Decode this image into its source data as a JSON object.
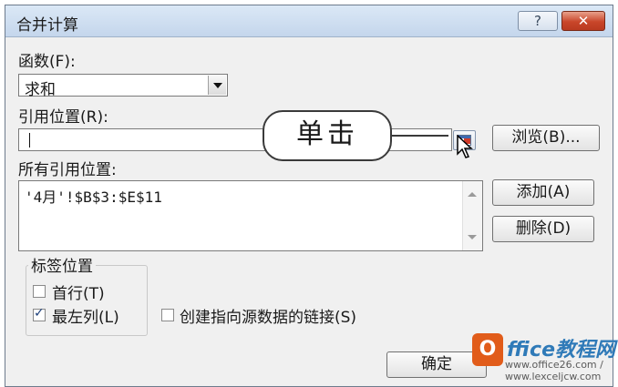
{
  "dialog": {
    "title": "合并计算",
    "help_label": "?",
    "close_label": "✕"
  },
  "function": {
    "label": "函数(F):",
    "selected": "求和"
  },
  "reference": {
    "label": "引用位置(R):",
    "value": "",
    "browse_label": "浏览(B)..."
  },
  "all_references": {
    "label": "所有引用位置:",
    "items": [
      "'4月'!$B$3:$E$11"
    ],
    "add_label": "添加(A)",
    "delete_label": "删除(D)"
  },
  "label_position": {
    "group_label": "标签位置",
    "first_row": {
      "label": "首行(T)",
      "checked": false
    },
    "left_column": {
      "label": "最左列(L)",
      "checked": true
    }
  },
  "create_links": {
    "label": "创建指向源数据的链接(S)",
    "checked": false
  },
  "ok_label": "确定",
  "callout": {
    "text": "单击"
  },
  "watermark": {
    "logo_text": "O",
    "name": "ffice教程网",
    "url": "www.office26.com / www.lexceljcw.com"
  },
  "colors": {
    "title_bar": "#c4d6ec",
    "close_button": "#c9462a",
    "watermark_brand": "#2f7ab8",
    "watermark_logo": "#e15c1a"
  }
}
